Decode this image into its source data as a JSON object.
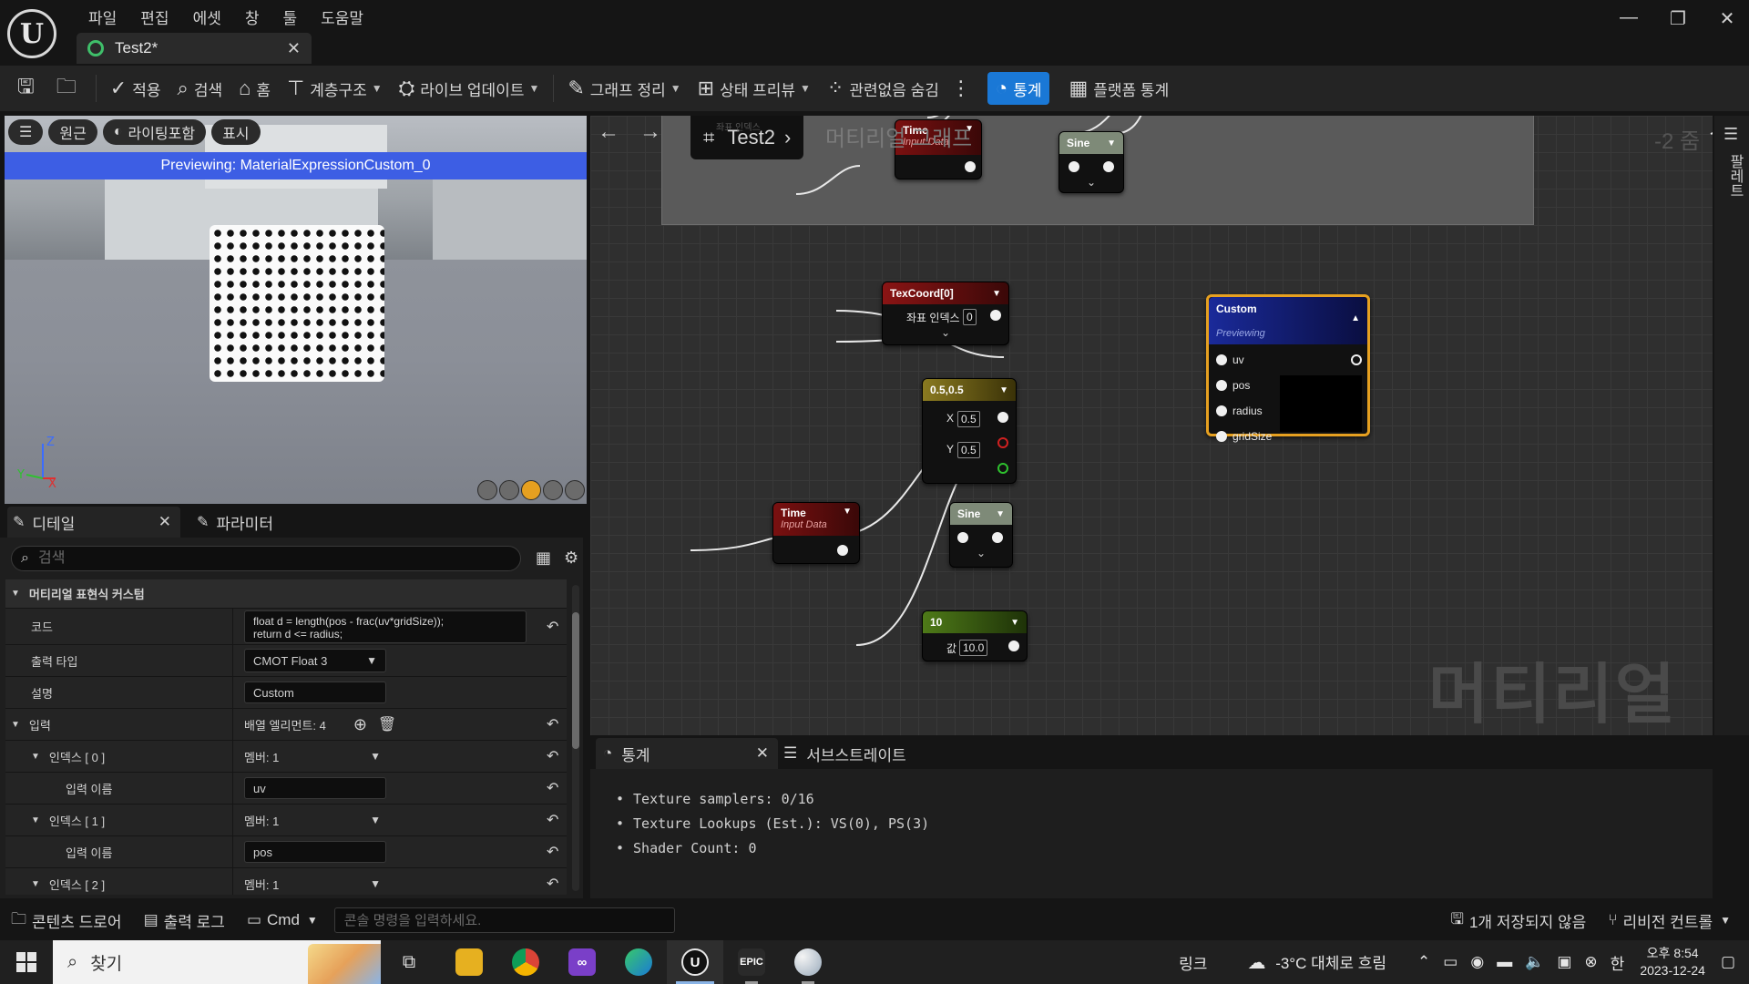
{
  "app": {
    "menus": [
      "파일",
      "편집",
      "에셋",
      "창",
      "툴",
      "도움말"
    ],
    "tab_title": "Test2*",
    "window_controls": {
      "minimize": "—",
      "restore": "❐",
      "close": "✕"
    }
  },
  "toolbar": {
    "apply": "적용",
    "search": "검색",
    "home": "홈",
    "hierarchy": "계층구조",
    "live_update": "라이브 업데이트",
    "graph_clean": "그래프 정리",
    "state_preview": "상태 프리뷰",
    "hide_unrelated": "관련없음 숨김",
    "stats": "통계",
    "platform_stats": "플랫폼 통계"
  },
  "viewport": {
    "buttons": [
      "원근",
      "라이팅포함",
      "표시"
    ],
    "banner": "Previewing: MaterialExpressionCustom_0",
    "axes": {
      "z": "Z",
      "x": "X",
      "y": "Y"
    }
  },
  "details": {
    "tab": "디테일",
    "params_tab": "파라미터",
    "search_placeholder": "검색",
    "category": "머티리얼 표현식 커스텀",
    "code_label": "코드",
    "code_line1": "float d = length(pos - frac(uv*gridSize));",
    "code_line2": "return d <= radius;",
    "output_type_label": "출력 타입",
    "output_type_value": "CMOT Float 3",
    "description_label": "설명",
    "description_value": "Custom",
    "inputs_label": "입력",
    "inputs_value": "배열 엘리먼트: 4",
    "input_items": [
      {
        "index": "인덱스 [ 0 ]",
        "member": "멤버: 1",
        "name_label": "입력 이름",
        "name_value": "uv"
      },
      {
        "index": "인덱스 [ 1 ]",
        "member": "멤버: 1",
        "name_label": "입력 이름",
        "name_value": "pos"
      },
      {
        "index": "인덱스 [ 2 ]",
        "member": "멤버: 1"
      }
    ]
  },
  "graph": {
    "breadcrumb": "Test2",
    "title": "머티리얼 그래프",
    "zoom": "-2 줌",
    "watermark": "머티리얼",
    "comment_hint": "좌표 인덱스",
    "nodes": {
      "time_top": {
        "title": "Time",
        "subtitle": "Input Data"
      },
      "sine_top": {
        "title": "Sine"
      },
      "texcoord": {
        "title": "TexCoord[0]",
        "field_label": "좌표 인덱스",
        "field_value": "0"
      },
      "const2": {
        "title": "0.5,0.5",
        "x_label": "X",
        "x_value": "0.5",
        "y_label": "Y",
        "y_value": "0.5"
      },
      "time": {
        "title": "Time",
        "subtitle": "Input Data"
      },
      "sine": {
        "title": "Sine"
      },
      "const1": {
        "title": "10",
        "field_label": "값",
        "field_value": "10.0"
      },
      "custom": {
        "title": "Custom",
        "subtitle": "Previewing",
        "inputs": [
          "uv",
          "pos",
          "radius",
          "gridSize"
        ]
      }
    }
  },
  "palette": {
    "label": "팔레트"
  },
  "stats": {
    "tab": "통계",
    "substrate_tab": "서브스트레이트",
    "lines": [
      "Texture samplers: 0/16",
      "Texture Lookups (Est.): VS(0), PS(3)",
      "Shader Count: 0"
    ]
  },
  "statusbar": {
    "content_drawer": "콘텐츠 드로어",
    "output_log": "출력 로그",
    "cmd": "Cmd",
    "console_placeholder": "콘솔 명령을 입력하세요.",
    "unsaved": "1개 저장되지 않음",
    "revision": "리비전 컨트롤"
  },
  "taskbar": {
    "search_label": "찾기",
    "apps": [
      "task-view",
      "file-explorer",
      "chrome",
      "visual-studio",
      "edge",
      "unreal-engine",
      "epic-games",
      "paint"
    ],
    "epic_label": "EPIC",
    "link": "링크",
    "weather": "-3°C 대체로 흐림",
    "ime": "한",
    "time": "오후 8:54",
    "date": "2023-12-24"
  }
}
